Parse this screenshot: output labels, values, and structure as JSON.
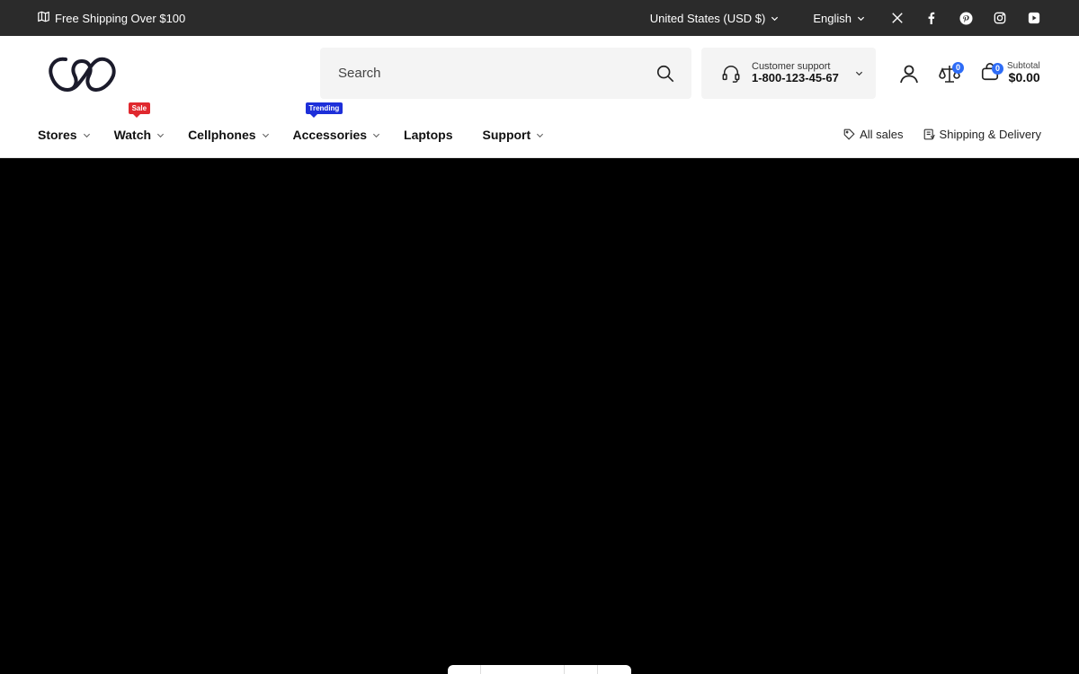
{
  "topbar": {
    "shipping_text": "Free Shipping Over $100",
    "currency": "United States (USD $)",
    "language": "English",
    "social_icons": [
      "x-icon",
      "facebook-icon",
      "pinterest-icon",
      "instagram-icon",
      "youtube-icon"
    ]
  },
  "header": {
    "search_placeholder": "Search",
    "support_label": "Customer support",
    "support_phone": "1-800-123-45-67",
    "compare_count": "0",
    "cart_count": "0",
    "subtotal_label": "Subtotal",
    "subtotal_value": "$0.00"
  },
  "nav": {
    "items": [
      {
        "label": "Stores"
      },
      {
        "label": "Watch",
        "tag": "Sale"
      },
      {
        "label": "Cellphones"
      },
      {
        "label": "Accessories",
        "tag": "Trending"
      },
      {
        "label": "Laptops"
      },
      {
        "label": "Support"
      }
    ],
    "all_sales": "All sales",
    "shipping_delivery": "Shipping & Delivery"
  },
  "colors": {
    "topbar_bg": "#2b2b2b",
    "badge_blue": "#2e6cf6",
    "sale_red": "#e0282e",
    "trending_blue": "#1d2fd9"
  }
}
